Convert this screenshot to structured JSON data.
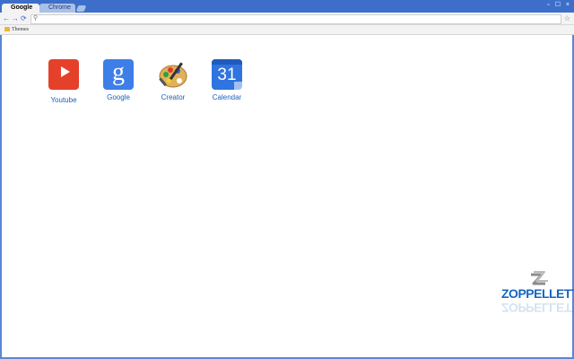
{
  "tabs": [
    {
      "label": "Google",
      "active": true
    },
    {
      "label": "Chrome",
      "active": false
    }
  ],
  "window_controls": "▫ ☐ ×",
  "toolbar": {
    "back_icon": "←",
    "forward_icon": "→",
    "reload_icon": "⟳",
    "search_icon": "⚲",
    "star_icon": "☆",
    "omnibox_value": ""
  },
  "bookmarks": [
    {
      "label": "Themes",
      "icon": "theme-icon"
    }
  ],
  "apps": [
    {
      "label": "Youtube",
      "icon": "youtube-icon",
      "color": "#e5402a"
    },
    {
      "label": "Google",
      "icon": "google-icon",
      "glyph": "g",
      "color": "#3d7ee8"
    },
    {
      "label": "Creator",
      "icon": "palette-icon"
    },
    {
      "label": "Calendar",
      "icon": "calendar-icon",
      "glyph": "31",
      "color": "#2f74e0"
    }
  ],
  "watermark": {
    "text": "ZOPPELLETTO",
    "color": "#1565c0"
  }
}
